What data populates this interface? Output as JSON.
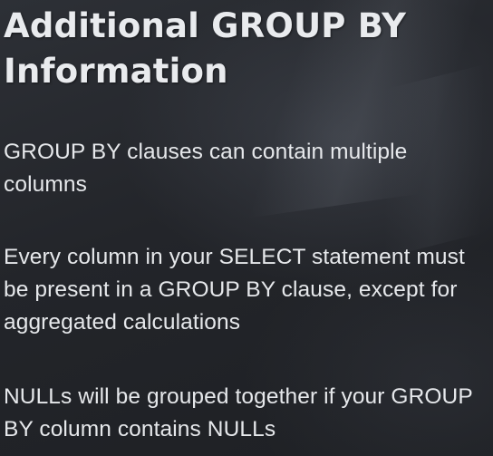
{
  "slide": {
    "title": "Additional GROUP BY Information",
    "bullets": [
      {
        "text": "GROUP BY clauses can contain multiple columns"
      },
      {
        "text": "Every column in your SELECT statement must be present in a GROUP BY clause, except for aggregated calculations"
      },
      {
        "text": "NULLs will be grouped together if your GROUP BY column contains NULLs"
      }
    ]
  }
}
